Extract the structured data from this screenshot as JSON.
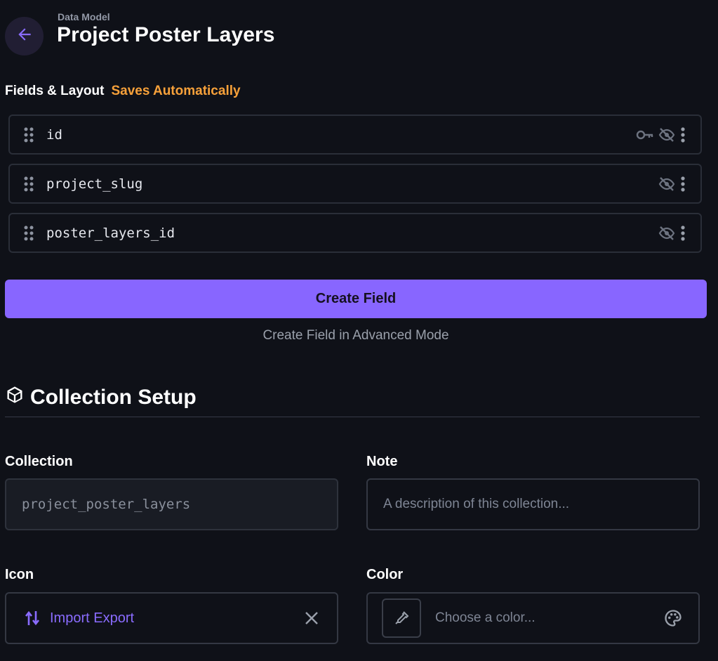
{
  "header": {
    "breadcrumb": "Data Model",
    "title": "Project Poster Layers",
    "back_icon": "arrow-left-icon"
  },
  "fields_section": {
    "title": "Fields & Layout",
    "status": "Saves Automatically",
    "fields": [
      {
        "name": "id",
        "icons": [
          "key-icon",
          "hidden-eye-icon",
          "more-vert-icon"
        ]
      },
      {
        "name": "project_slug",
        "icons": [
          "hidden-eye-icon",
          "more-vert-icon"
        ]
      },
      {
        "name": "poster_layers_id",
        "icons": [
          "hidden-eye-icon",
          "more-vert-icon"
        ]
      }
    ],
    "create_button": "Create Field",
    "advanced_link": "Create Field in Advanced Mode"
  },
  "collection_setup": {
    "title": "Collection Setup",
    "title_icon": "box-icon",
    "collection": {
      "label": "Collection",
      "value": "project_poster_layers"
    },
    "note": {
      "label": "Note",
      "placeholder": "A description of this collection..."
    },
    "icon": {
      "label": "Icon",
      "value": "Import Export",
      "icon_name": "import-export-icon"
    },
    "color": {
      "label": "Color",
      "placeholder": "Choose a color...",
      "picker_icon": "eyedropper-icon",
      "palette_icon": "palette-icon"
    }
  },
  "colors": {
    "background": "#0f1118",
    "accent": "#8866ff",
    "status_orange": "#f7a13a"
  }
}
